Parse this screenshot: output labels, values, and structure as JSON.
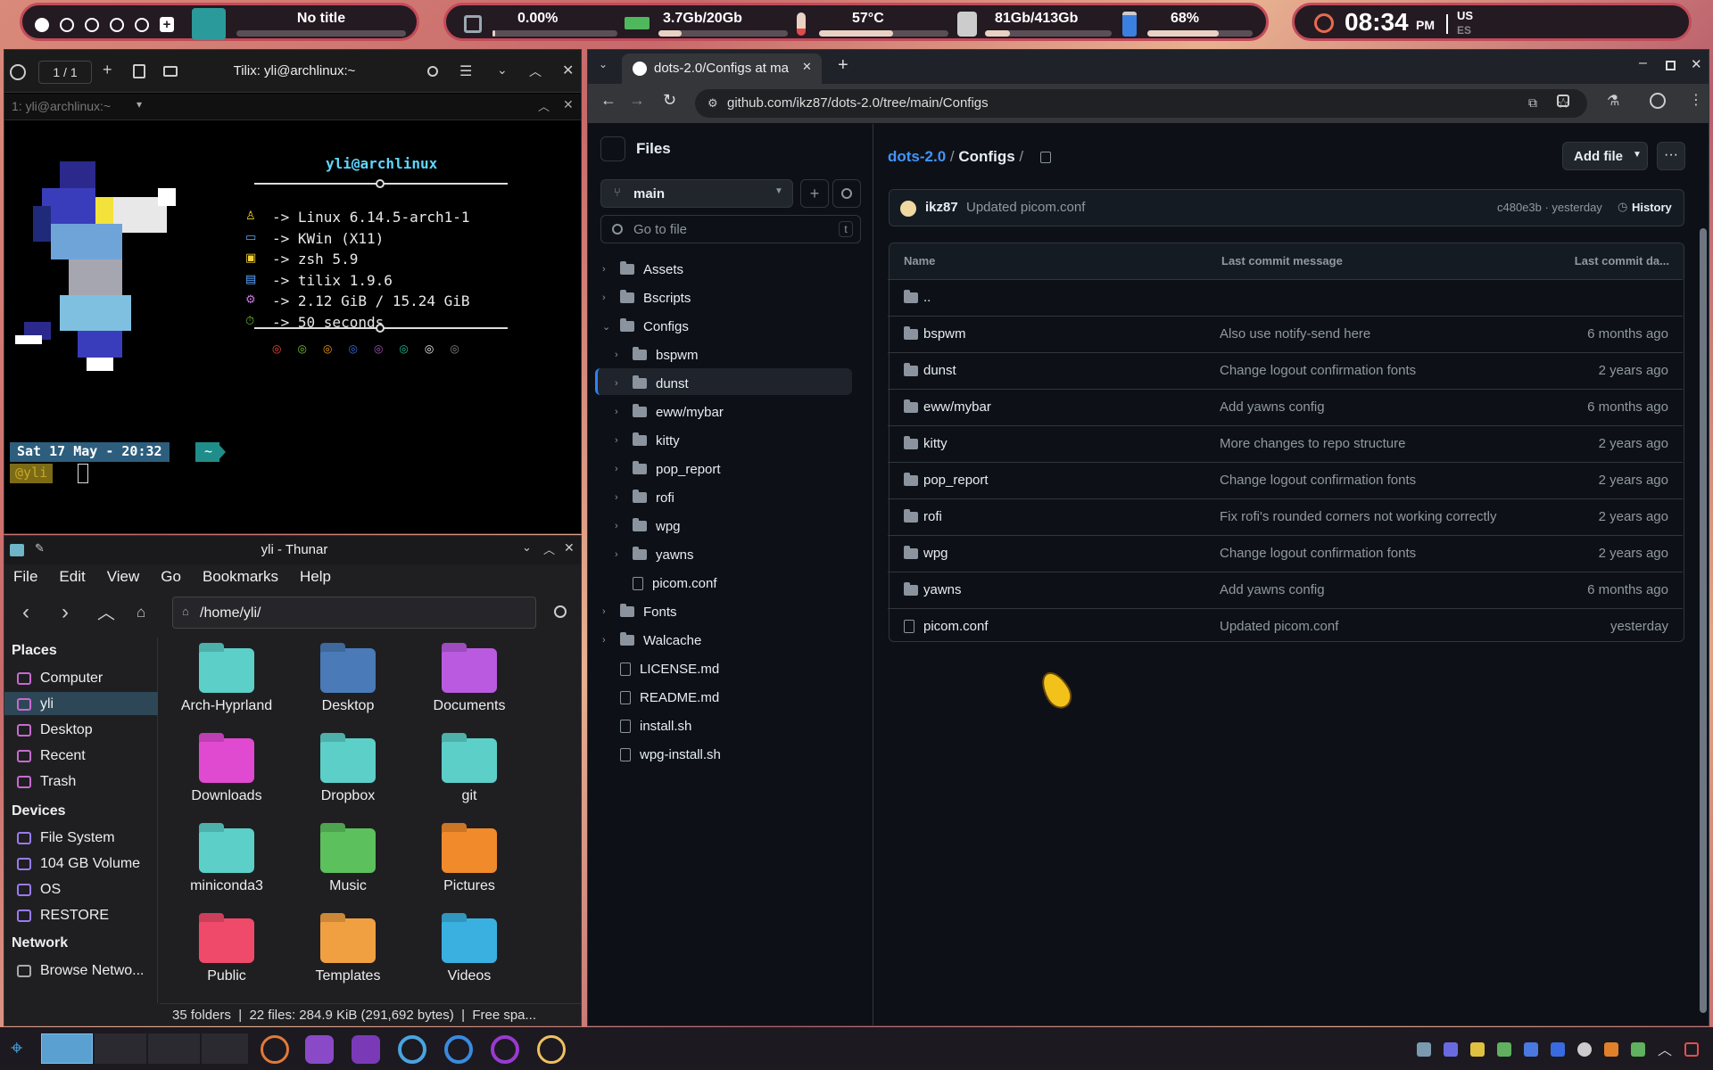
{
  "topbar": {
    "window_title": "No title",
    "cpu": "0.00%",
    "cpu_level": 0.02,
    "ram": "3.7Gb/20Gb",
    "ram_level": 0.18,
    "temp": "57°C",
    "temp_level": 0.57,
    "disk": "81Gb/413Gb",
    "disk_level": 0.2,
    "battery": "68%",
    "battery_level": 0.68,
    "time": "08:34",
    "ampm": "PM",
    "lang1": "US",
    "lang2": "ES"
  },
  "terminal": {
    "title": "Tilix: yli@archlinux:~",
    "tab_counter": "1 / 1",
    "session": "1: yli@archlinux:~",
    "user": "yli@archlinux",
    "lines": [
      "-> Linux 6.14.5-arch1-1",
      "-> KWin (X11)",
      "-> zsh 5.9",
      "-> tilix 1.9.6",
      "-> 2.12 GiB / 15.24 GiB",
      "-> 50 seconds"
    ],
    "prompt_date": "Sat 17 May - 20:32",
    "prompt_dir": "~",
    "prompt_user": "@yli"
  },
  "thunar": {
    "title": "yli - Thunar",
    "menu": [
      "File",
      "Edit",
      "View",
      "Go",
      "Bookmarks",
      "Help"
    ],
    "path": "/home/yli/",
    "places_header": "Places",
    "places": [
      "Computer",
      "yli",
      "Desktop",
      "Recent",
      "Trash"
    ],
    "devices_header": "Devices",
    "devices": [
      "File System",
      "104 GB Volume",
      "OS",
      "RESTORE"
    ],
    "network_header": "Network",
    "network": [
      "Browse Netwo..."
    ],
    "folders": [
      "Arch-Hyprland",
      "Desktop",
      "Documents",
      "Downloads",
      "Dropbox",
      "git",
      "miniconda3",
      "Music",
      "Pictures",
      "Public",
      "Templates",
      "Videos"
    ],
    "status": "35 folders  |  22 files: 284.9 KiB (291,692 bytes)  |  Free spa..."
  },
  "browser": {
    "tab_title": "dots-2.0/Configs at ma",
    "url": "github.com/ikz87/dots-2.0/tree/main/Configs",
    "files_header": "Files",
    "branch": "main",
    "goto_placeholder": "Go to file",
    "goto_key": "t",
    "tree": [
      {
        "label": "Assets",
        "type": "dir",
        "level": 0,
        "open": false
      },
      {
        "label": "Bscripts",
        "type": "dir",
        "level": 0,
        "open": false
      },
      {
        "label": "Configs",
        "type": "dir",
        "level": 0,
        "open": true
      },
      {
        "label": "bspwm",
        "type": "dir",
        "level": 1,
        "open": false
      },
      {
        "label": "dunst",
        "type": "dir",
        "level": 1,
        "open": false
      },
      {
        "label": "eww/mybar",
        "type": "dir",
        "level": 1,
        "open": false
      },
      {
        "label": "kitty",
        "type": "dir",
        "level": 1,
        "open": false
      },
      {
        "label": "pop_report",
        "type": "dir",
        "level": 1,
        "open": false
      },
      {
        "label": "rofi",
        "type": "dir",
        "level": 1,
        "open": false
      },
      {
        "label": "wpg",
        "type": "dir",
        "level": 1,
        "open": false
      },
      {
        "label": "yawns",
        "type": "dir",
        "level": 1,
        "open": false
      },
      {
        "label": "picom.conf",
        "type": "file",
        "level": 1
      },
      {
        "label": "Fonts",
        "type": "dir",
        "level": 0,
        "open": false
      },
      {
        "label": "Walcache",
        "type": "dir",
        "level": 0,
        "open": false
      },
      {
        "label": "LICENSE.md",
        "type": "file",
        "level": 0
      },
      {
        "label": "README.md",
        "type": "file",
        "level": 0
      },
      {
        "label": "install.sh",
        "type": "file",
        "level": 0
      },
      {
        "label": "wpg-install.sh",
        "type": "file",
        "level": 0
      }
    ],
    "crumb_repo": "dots-2.0",
    "crumb_sep": "/",
    "crumb_dir": "Configs",
    "crumb_tail": "/",
    "add_file": "Add file",
    "commit": {
      "author": "ikz87",
      "message": "Updated picom.conf",
      "hash": "c480e3b · yesterday",
      "history": "History"
    },
    "headers": [
      "Name",
      "Last commit message",
      "Last commit da..."
    ],
    "parent": "..",
    "rows": [
      {
        "name": "bspwm",
        "msg": "Also use notify-send here",
        "date": "6 months ago",
        "type": "dir"
      },
      {
        "name": "dunst",
        "msg": "Change logout confirmation fonts",
        "date": "2 years ago",
        "type": "dir"
      },
      {
        "name": "eww/mybar",
        "msg": "Add yawns config",
        "date": "6 months ago",
        "type": "dir"
      },
      {
        "name": "kitty",
        "msg": "More changes to repo structure",
        "date": "2 years ago",
        "type": "dir"
      },
      {
        "name": "pop_report",
        "msg": "Change logout confirmation fonts",
        "date": "2 years ago",
        "type": "dir"
      },
      {
        "name": "rofi",
        "msg": "Fix rofi's rounded corners not working correctly",
        "date": "2 years ago",
        "type": "dir"
      },
      {
        "name": "wpg",
        "msg": "Change logout confirmation fonts",
        "date": "2 years ago",
        "type": "dir"
      },
      {
        "name": "yawns",
        "msg": "Add yawns config",
        "date": "6 months ago",
        "type": "dir"
      },
      {
        "name": "picom.conf",
        "msg": "Updated picom.conf",
        "date": "yesterday",
        "type": "file"
      }
    ]
  }
}
